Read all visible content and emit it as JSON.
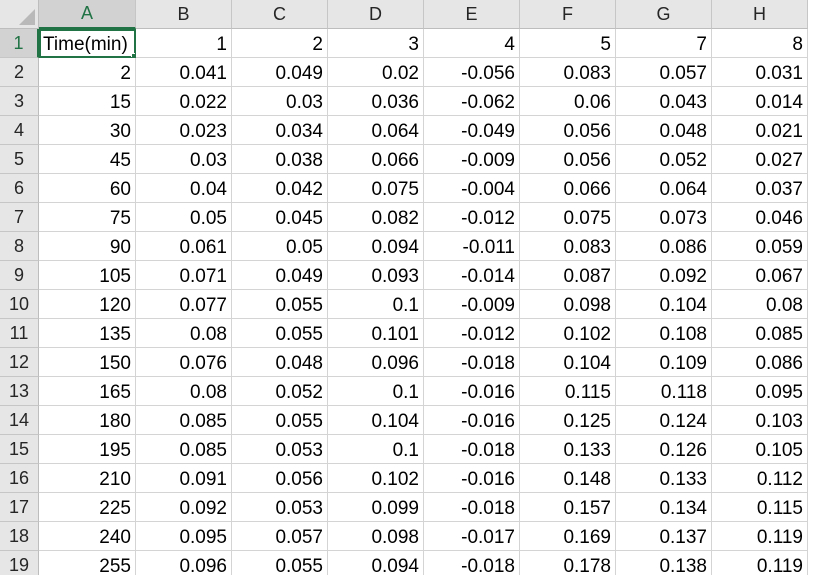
{
  "columns": [
    "A",
    "B",
    "C",
    "D",
    "E",
    "F",
    "G",
    "H"
  ],
  "rows": [
    {
      "n": "1",
      "cells": [
        "Time(min)",
        "1",
        "2",
        "3",
        "4",
        "5",
        "7",
        "8"
      ]
    },
    {
      "n": "2",
      "cells": [
        "2",
        "0.041",
        "0.049",
        "0.02",
        "-0.056",
        "0.083",
        "0.057",
        "0.031"
      ]
    },
    {
      "n": "3",
      "cells": [
        "15",
        "0.022",
        "0.03",
        "0.036",
        "-0.062",
        "0.06",
        "0.043",
        "0.014"
      ]
    },
    {
      "n": "4",
      "cells": [
        "30",
        "0.023",
        "0.034",
        "0.064",
        "-0.049",
        "0.056",
        "0.048",
        "0.021"
      ]
    },
    {
      "n": "5",
      "cells": [
        "45",
        "0.03",
        "0.038",
        "0.066",
        "-0.009",
        "0.056",
        "0.052",
        "0.027"
      ]
    },
    {
      "n": "6",
      "cells": [
        "60",
        "0.04",
        "0.042",
        "0.075",
        "-0.004",
        "0.066",
        "0.064",
        "0.037"
      ]
    },
    {
      "n": "7",
      "cells": [
        "75",
        "0.05",
        "0.045",
        "0.082",
        "-0.012",
        "0.075",
        "0.073",
        "0.046"
      ]
    },
    {
      "n": "8",
      "cells": [
        "90",
        "0.061",
        "0.05",
        "0.094",
        "-0.011",
        "0.083",
        "0.086",
        "0.059"
      ]
    },
    {
      "n": "9",
      "cells": [
        "105",
        "0.071",
        "0.049",
        "0.093",
        "-0.014",
        "0.087",
        "0.092",
        "0.067"
      ]
    },
    {
      "n": "10",
      "cells": [
        "120",
        "0.077",
        "0.055",
        "0.1",
        "-0.009",
        "0.098",
        "0.104",
        "0.08"
      ]
    },
    {
      "n": "11",
      "cells": [
        "135",
        "0.08",
        "0.055",
        "0.101",
        "-0.012",
        "0.102",
        "0.108",
        "0.085"
      ]
    },
    {
      "n": "12",
      "cells": [
        "150",
        "0.076",
        "0.048",
        "0.096",
        "-0.018",
        "0.104",
        "0.109",
        "0.086"
      ]
    },
    {
      "n": "13",
      "cells": [
        "165",
        "0.08",
        "0.052",
        "0.1",
        "-0.016",
        "0.115",
        "0.118",
        "0.095"
      ]
    },
    {
      "n": "14",
      "cells": [
        "180",
        "0.085",
        "0.055",
        "0.104",
        "-0.016",
        "0.125",
        "0.124",
        "0.103"
      ]
    },
    {
      "n": "15",
      "cells": [
        "195",
        "0.085",
        "0.053",
        "0.1",
        "-0.018",
        "0.133",
        "0.126",
        "0.105"
      ]
    },
    {
      "n": "16",
      "cells": [
        "210",
        "0.091",
        "0.056",
        "0.102",
        "-0.016",
        "0.148",
        "0.133",
        "0.112"
      ]
    },
    {
      "n": "17",
      "cells": [
        "225",
        "0.092",
        "0.053",
        "0.099",
        "-0.018",
        "0.157",
        "0.134",
        "0.115"
      ]
    },
    {
      "n": "18",
      "cells": [
        "240",
        "0.095",
        "0.057",
        "0.098",
        "-0.017",
        "0.169",
        "0.137",
        "0.119"
      ]
    },
    {
      "n": "19",
      "cells": [
        "255",
        "0.096",
        "0.055",
        "0.094",
        "-0.018",
        "0.178",
        "0.138",
        "0.119"
      ]
    }
  ],
  "active_cell": "A1",
  "colors": {
    "accent": "#217346",
    "header_bg": "#e6e6e6",
    "gridline": "#d4d4d4"
  }
}
